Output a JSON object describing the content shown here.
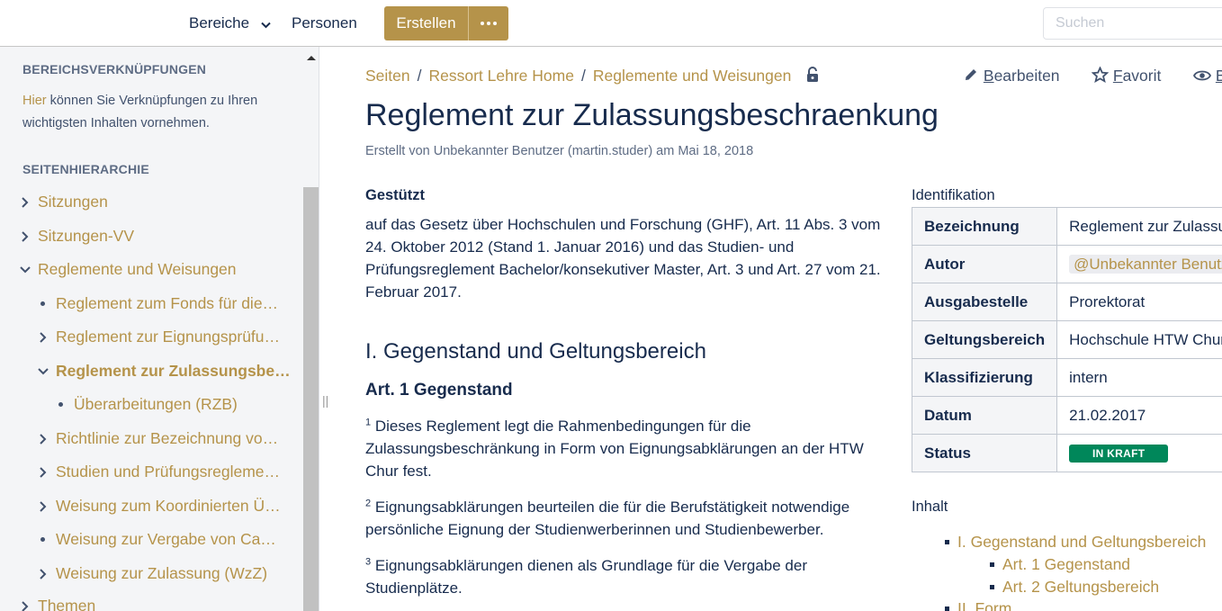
{
  "header": {
    "bereiche_label": "Bereiche",
    "personen_label": "Personen",
    "create_label": "Erstellen",
    "search_placeholder": "Suchen"
  },
  "sidebar": {
    "links_heading": "BEREICHSVERKNÜPFUNGEN",
    "links_text_link": "Hier",
    "links_text_rest": " können Sie Verknüpfungen zu Ihren wichtigsten Inhalten vornehmen.",
    "hierarchy_heading": "SEITENHIERARCHIE",
    "tree": [
      {
        "label": "Sitzungen",
        "marker": "chevron-right"
      },
      {
        "label": "Sitzungen-VV",
        "marker": "chevron-right"
      },
      {
        "label": "Reglemente und Weisungen",
        "marker": "chevron-down"
      },
      {
        "label": "Reglement zum Fonds für die…",
        "marker": "dot"
      },
      {
        "label": "Reglement zur Eignungsprüfu…",
        "marker": "chevron-right"
      },
      {
        "label": "Reglement zur Zulassungsbe…",
        "marker": "chevron-down"
      },
      {
        "label": "Überarbeitungen (RZB)",
        "marker": "dot"
      },
      {
        "label": "Richtlinie zur Bezeichnung vo…",
        "marker": "chevron-right"
      },
      {
        "label": "Studien und Prüfungsregleme…",
        "marker": "chevron-right"
      },
      {
        "label": "Weisung zum Koordinierten Ü…",
        "marker": "chevron-right"
      },
      {
        "label": "Weisung zur Vergabe von Ca…",
        "marker": "dot"
      },
      {
        "label": "Weisung zur Zulassung (WzZ)",
        "marker": "chevron-right"
      },
      {
        "label": "Themen",
        "marker": "chevron-right"
      }
    ]
  },
  "page": {
    "breadcrumb": [
      "Seiten",
      "Ressort Lehre Home",
      "Reglemente und Weisungen"
    ],
    "actions": {
      "edit_first": "B",
      "edit_rest": "earbeiten",
      "fav_first": "F",
      "fav_rest": "avorit",
      "watch_first": "B"
    },
    "title": "Reglement zur Zulassungsbeschraenkung",
    "byline": "Erstellt von Unbekannter Benutzer (martin.studer) am Mai 18, 2018",
    "basis_heading": "Gestützt",
    "basis_text": "auf das Gesetz über Hochschulen und Forschung (GHF), Art. 11 Abs. 3 vom 24. Oktober 2012 (Stand 1. Januar 2016) und das Studien- und Prüfungsreglement Bachelor/konsekutiver Master, Art. 3 und Art. 27 vom 21. Februar 2017.",
    "section1_heading": "I. Gegenstand und Geltungsbereich",
    "art1_heading": "Art. 1 Gegenstand",
    "art1_paragraphs": [
      {
        "num": "1",
        "text": " Dieses Reglement legt die Rahmenbedingungen für die Zulassungsbeschränkung in Form von Eignungsabklärungen an der HTW Chur fest."
      },
      {
        "num": "2",
        "text": " Eignungsabklärungen beurteilen die für die Berufstätigkeit notwendige persönliche Eignung der Studienwerberinnen und Studienbewerber."
      },
      {
        "num": "3",
        "text": " Eignungsabklärungen dienen als Grundlage für die Vergabe der Studienplätze."
      }
    ]
  },
  "info": {
    "caption": "Identifikation",
    "rows": [
      {
        "key": "Bezeichnung",
        "value": "Reglement zur Zulassu"
      },
      {
        "key": "Autor",
        "value": "@Unbekannter Benutz"
      },
      {
        "key": "Ausgabestelle",
        "value": "Prorektorat"
      },
      {
        "key": "Geltungsbereich",
        "value": "Hochschule HTW Chur"
      },
      {
        "key": "Klassifizierung",
        "value": "intern"
      },
      {
        "key": "Datum",
        "value": "21.02.2017"
      },
      {
        "key": "Status",
        "value": "IN KRAFT"
      }
    ],
    "status_color": "#00875a"
  },
  "toc": {
    "caption": "Inhalt",
    "items": [
      {
        "label": "I. Gegenstand und Geltungsbereich",
        "level": 1
      },
      {
        "label": "Art. 1 Gegenstand",
        "level": 2
      },
      {
        "label": "Art. 2 Geltungsbereich",
        "level": 2
      },
      {
        "label": "II. Form",
        "level": 1
      }
    ]
  },
  "colors": {
    "accent": "#b5934a",
    "text": "#172b4d",
    "sidebar_bg": "#f4f5f7"
  }
}
